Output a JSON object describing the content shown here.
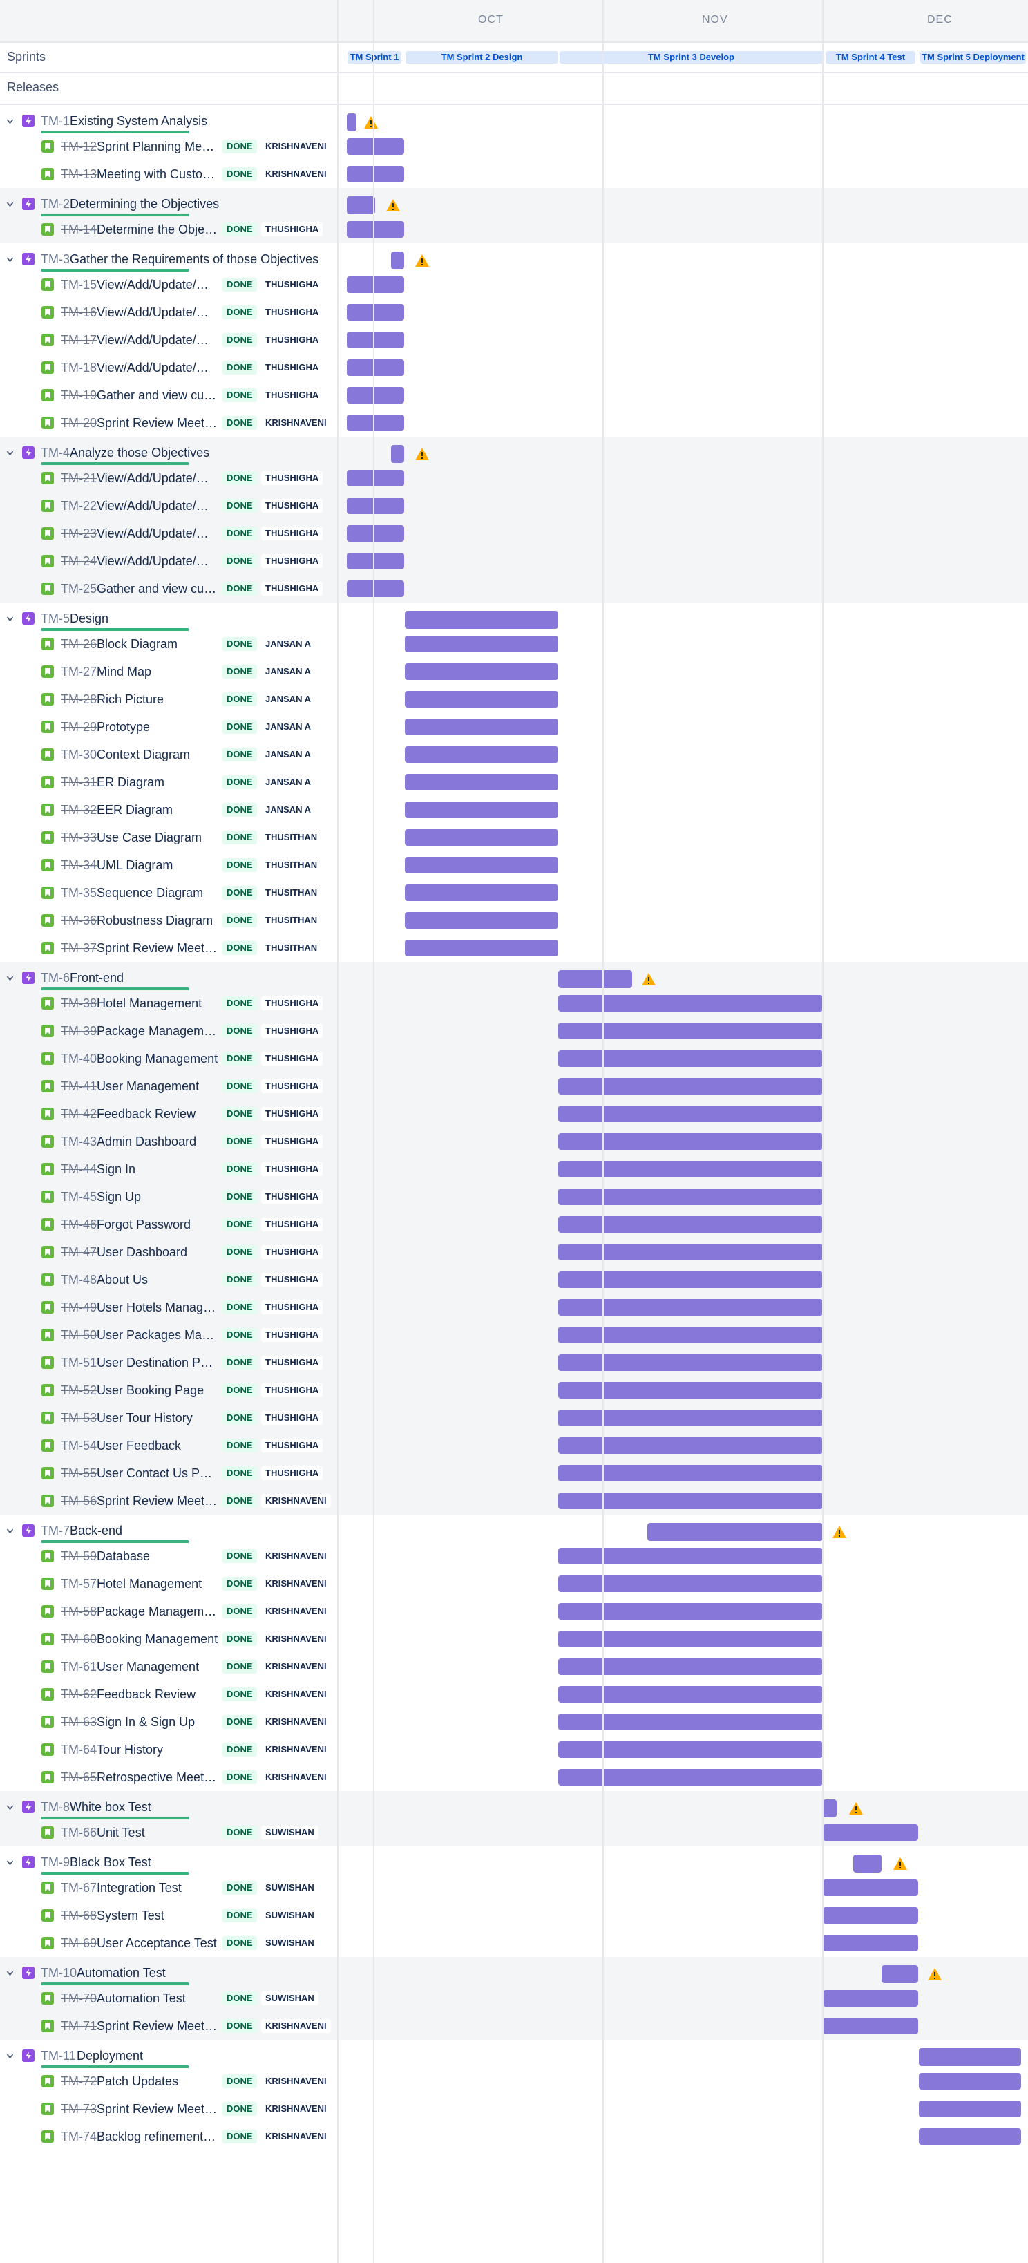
{
  "timeline": {
    "months": [
      "OCT",
      "NOV",
      "DEC"
    ],
    "sprints_label": "Sprints",
    "releases_label": "Releases",
    "sprints": [
      "TM Sprint 1",
      "TM Sprint 2 Design",
      "TM Sprint 3 Develop",
      "TM Sprint 4 Test",
      "TM Sprint 5 Deployment"
    ],
    "status_label": "DONE",
    "colors": {
      "bar": "#8777d9",
      "epic_icon": "#904ee2",
      "story_icon": "#63ba3c",
      "done_badge": "#e3fcef",
      "progress": "#36b37e",
      "warning": "#ffab00"
    }
  },
  "epics": [
    {
      "key": "TM-1",
      "title": "Existing System Analysis",
      "warning": true,
      "stories": [
        {
          "key": "TM-12",
          "title": "Sprint Planning Meeting",
          "assignee": "KRISHNAVENI"
        },
        {
          "key": "TM-13",
          "title": "Meeting with Customer",
          "assignee": "KRISHNAVENI"
        }
      ]
    },
    {
      "key": "TM-2",
      "title": "Determining the Objectives",
      "warning": true,
      "stories": [
        {
          "key": "TM-14",
          "title": "Determine the Objectives",
          "assignee": "THUSHIGHA"
        }
      ]
    },
    {
      "key": "TM-3",
      "title": "Gather the Requirements of those Objectives",
      "warning": true,
      "stories": [
        {
          "key": "TM-15",
          "title": "View/Add/Update/Manage",
          "assignee": "THUSHIGHA"
        },
        {
          "key": "TM-16",
          "title": "View/Add/Update/Manage",
          "assignee": "THUSHIGHA"
        },
        {
          "key": "TM-17",
          "title": "View/Add/Update/Manage",
          "assignee": "THUSHIGHA"
        },
        {
          "key": "TM-18",
          "title": "View/Add/Update/Manage",
          "assignee": "THUSHIGHA"
        },
        {
          "key": "TM-19",
          "title": "Gather and view customer",
          "assignee": "THUSHIGHA"
        },
        {
          "key": "TM-20",
          "title": "Sprint Review Meeting",
          "assignee": "KRISHNAVENI"
        }
      ]
    },
    {
      "key": "TM-4",
      "title": "Analyze those Objectives",
      "warning": true,
      "stories": [
        {
          "key": "TM-21",
          "title": "View/Add/Update/Manage",
          "assignee": "THUSHIGHA"
        },
        {
          "key": "TM-22",
          "title": "View/Add/Update/Manage",
          "assignee": "THUSHIGHA"
        },
        {
          "key": "TM-23",
          "title": "View/Add/Update/Manage",
          "assignee": "THUSHIGHA"
        },
        {
          "key": "TM-24",
          "title": "View/Add/Update/Manage",
          "assignee": "THUSHIGHA"
        },
        {
          "key": "TM-25",
          "title": "Gather and view customer",
          "assignee": "THUSHIGHA"
        }
      ]
    },
    {
      "key": "TM-5",
      "title": "Design",
      "warning": false,
      "stories": [
        {
          "key": "TM-26",
          "title": "Block Diagram",
          "assignee": "JANSAN A"
        },
        {
          "key": "TM-27",
          "title": "Mind Map",
          "assignee": "JANSAN A"
        },
        {
          "key": "TM-28",
          "title": "Rich Picture",
          "assignee": "JANSAN A"
        },
        {
          "key": "TM-29",
          "title": "Prototype",
          "assignee": "JANSAN A"
        },
        {
          "key": "TM-30",
          "title": "Context Diagram",
          "assignee": "JANSAN A"
        },
        {
          "key": "TM-31",
          "title": "ER Diagram",
          "assignee": "JANSAN A"
        },
        {
          "key": "TM-32",
          "title": "EER Diagram",
          "assignee": "JANSAN A"
        },
        {
          "key": "TM-33",
          "title": "Use Case Diagram",
          "assignee": "THUSITHAN"
        },
        {
          "key": "TM-34",
          "title": "UML Diagram",
          "assignee": "THUSITHAN"
        },
        {
          "key": "TM-35",
          "title": "Sequence Diagram",
          "assignee": "THUSITHAN"
        },
        {
          "key": "TM-36",
          "title": "Robustness Diagram",
          "assignee": "THUSITHAN"
        },
        {
          "key": "TM-37",
          "title": "Sprint Review Meeting",
          "assignee": "THUSITHAN"
        }
      ]
    },
    {
      "key": "TM-6",
      "title": "Front-end",
      "warning": true,
      "stories": [
        {
          "key": "TM-38",
          "title": "Hotel Management",
          "assignee": "THUSHIGHA"
        },
        {
          "key": "TM-39",
          "title": "Package Management",
          "assignee": "THUSHIGHA"
        },
        {
          "key": "TM-40",
          "title": "Booking Management",
          "assignee": "THUSHIGHA"
        },
        {
          "key": "TM-41",
          "title": "User Management",
          "assignee": "THUSHIGHA"
        },
        {
          "key": "TM-42",
          "title": "Feedback Review",
          "assignee": "THUSHIGHA"
        },
        {
          "key": "TM-43",
          "title": "Admin Dashboard",
          "assignee": "THUSHIGHA"
        },
        {
          "key": "TM-44",
          "title": "Sign In",
          "assignee": "THUSHIGHA"
        },
        {
          "key": "TM-45",
          "title": "Sign Up",
          "assignee": "THUSHIGHA"
        },
        {
          "key": "TM-46",
          "title": "Forgot Password",
          "assignee": "THUSHIGHA"
        },
        {
          "key": "TM-47",
          "title": "User Dashboard",
          "assignee": "THUSHIGHA"
        },
        {
          "key": "TM-48",
          "title": "About Us",
          "assignee": "THUSHIGHA"
        },
        {
          "key": "TM-49",
          "title": "User Hotels Management",
          "assignee": "THUSHIGHA"
        },
        {
          "key": "TM-50",
          "title": "User Packages Management",
          "assignee": "THUSHIGHA"
        },
        {
          "key": "TM-51",
          "title": "User Destination Page",
          "assignee": "THUSHIGHA"
        },
        {
          "key": "TM-52",
          "title": "User Booking Page",
          "assignee": "THUSHIGHA"
        },
        {
          "key": "TM-53",
          "title": "User Tour History",
          "assignee": "THUSHIGHA"
        },
        {
          "key": "TM-54",
          "title": "User Feedback",
          "assignee": "THUSHIGHA"
        },
        {
          "key": "TM-55",
          "title": "User Contact Us Page",
          "assignee": "THUSHIGHA"
        },
        {
          "key": "TM-56",
          "title": "Sprint Review Meeting",
          "assignee": "KRISHNAVENI"
        }
      ]
    },
    {
      "key": "TM-7",
      "title": "Back-end",
      "warning": true,
      "stories": [
        {
          "key": "TM-59",
          "title": "Database",
          "assignee": "KRISHNAVENI"
        },
        {
          "key": "TM-57",
          "title": "Hotel Management",
          "assignee": "KRISHNAVENI"
        },
        {
          "key": "TM-58",
          "title": "Package Management",
          "assignee": "KRISHNAVENI"
        },
        {
          "key": "TM-60",
          "title": "Booking Management",
          "assignee": "KRISHNAVENI"
        },
        {
          "key": "TM-61",
          "title": "User Management",
          "assignee": "KRISHNAVENI"
        },
        {
          "key": "TM-62",
          "title": "Feedback Review",
          "assignee": "KRISHNAVENI"
        },
        {
          "key": "TM-63",
          "title": "Sign In & Sign Up",
          "assignee": "KRISHNAVENI"
        },
        {
          "key": "TM-64",
          "title": "Tour History",
          "assignee": "KRISHNAVENI"
        },
        {
          "key": "TM-65",
          "title": "Retrospective Meeting",
          "assignee": "KRISHNAVENI"
        }
      ]
    },
    {
      "key": "TM-8",
      "title": "White box Test",
      "warning": true,
      "stories": [
        {
          "key": "TM-66",
          "title": "Unit Test",
          "assignee": "SUWISHAN"
        }
      ]
    },
    {
      "key": "TM-9",
      "title": "Black Box Test",
      "warning": true,
      "stories": [
        {
          "key": "TM-67",
          "title": "Integration Test",
          "assignee": "SUWISHAN"
        },
        {
          "key": "TM-68",
          "title": "System Test",
          "assignee": "SUWISHAN"
        },
        {
          "key": "TM-69",
          "title": "User Acceptance Test",
          "assignee": "SUWISHAN"
        }
      ]
    },
    {
      "key": "TM-10",
      "title": "Automation Test",
      "warning": true,
      "stories": [
        {
          "key": "TM-70",
          "title": "Automation Test",
          "assignee": "SUWISHAN"
        },
        {
          "key": "TM-71",
          "title": "Sprint Review Meeting",
          "assignee": "KRISHNAVENI"
        }
      ]
    },
    {
      "key": "TM-11",
      "title": "Deployment",
      "warning": false,
      "stories": [
        {
          "key": "TM-72",
          "title": "Patch Updates",
          "assignee": "KRISHNAVENI"
        },
        {
          "key": "TM-73",
          "title": "Sprint Review Meeting",
          "assignee": "KRISHNAVENI"
        },
        {
          "key": "TM-74",
          "title": "Backlog refinement Meeting",
          "assignee": "KRISHNAVENI"
        }
      ]
    }
  ]
}
